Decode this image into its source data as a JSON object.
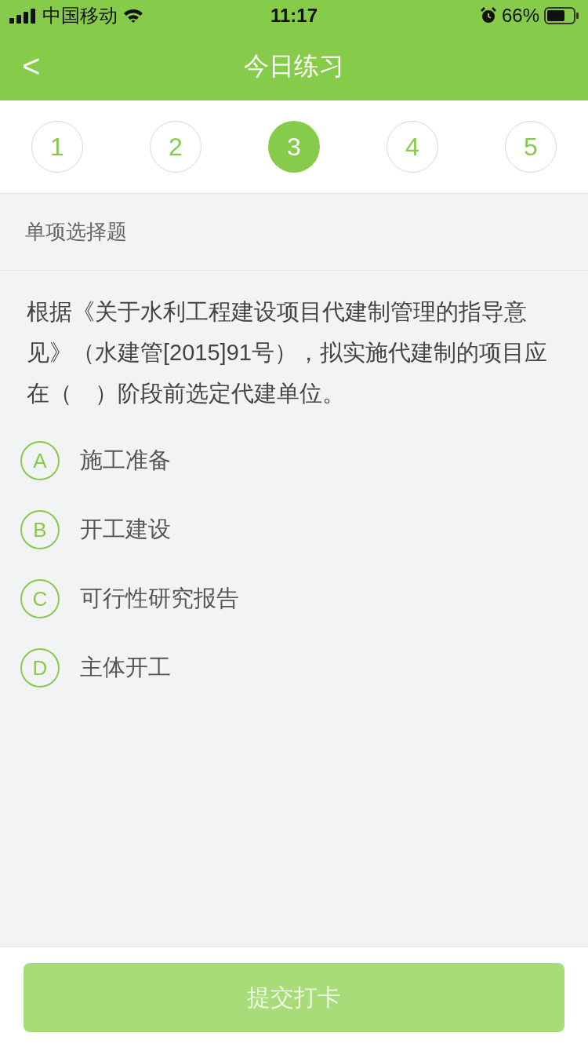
{
  "status_bar": {
    "carrier": "中国移动",
    "time": "11:17",
    "battery": "66%"
  },
  "nav": {
    "back": "<",
    "title": "今日练习"
  },
  "steps": [
    {
      "label": "1",
      "selected": false
    },
    {
      "label": "2",
      "selected": false
    },
    {
      "label": "3",
      "selected": true
    },
    {
      "label": "4",
      "selected": false
    },
    {
      "label": "5",
      "selected": false
    }
  ],
  "question_type": "单项选择题",
  "question": "根据《关于水利工程建设项目代建制管理的指导意见》（水建管[2015]91号），拟实施代建制的项目应在（　）阶段前选定代建单位。",
  "options": [
    {
      "letter": "A",
      "text": "施工准备",
      "selected": false
    },
    {
      "letter": "B",
      "text": "开工建设",
      "selected": false
    },
    {
      "letter": "C",
      "text": "可行性研究报告",
      "selected": false
    },
    {
      "letter": "D",
      "text": "主体开工",
      "selected": false
    }
  ],
  "submit": {
    "label": "提交打卡",
    "disabled": true
  }
}
